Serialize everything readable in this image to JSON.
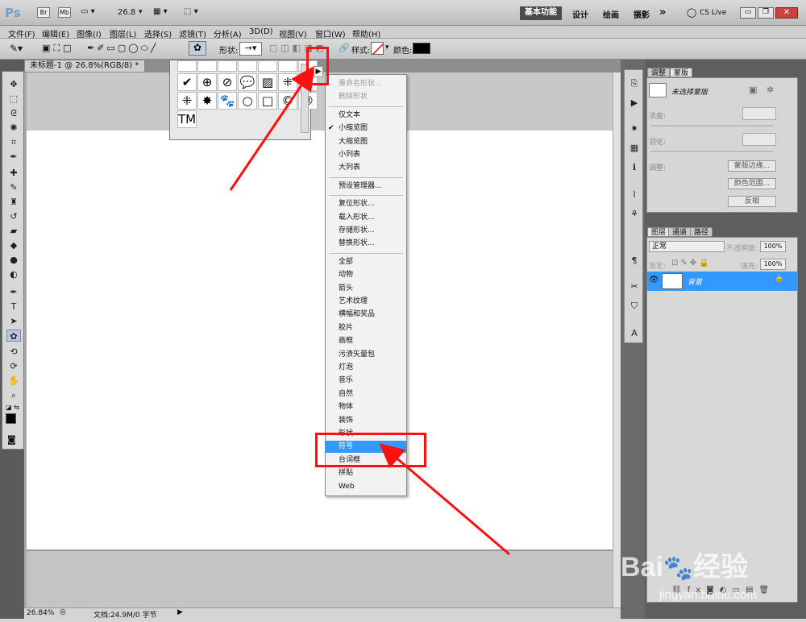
{
  "appbar": {
    "logo": "Ps",
    "br": "Br",
    "mb": "Mb",
    "zoom": "26.8",
    "workspace_basic": "基本功能",
    "workspace_design": "设计",
    "workspace_paint": "绘画",
    "workspace_photo": "摄影",
    "more": "»",
    "cslive": "CS Live"
  },
  "menubar": [
    "文件(F)",
    "编辑(E)",
    "图像(I)",
    "图层(L)",
    "选择(S)",
    "滤镜(T)",
    "分析(A)",
    "3D(D)",
    "视图(V)",
    "窗口(W)",
    "帮助(H)"
  ],
  "optbar": {
    "shape_label": "形状:",
    "style_label": "样式:",
    "color_label": "颜色:",
    "color_value": "#000000"
  },
  "doc": {
    "tab_title": "未标题-1 @ 26.8%(RGB/8) *",
    "zoom_status": "26.84%",
    "doc_status": "文档:24.9M/0 字节"
  },
  "shape_picker": {
    "glyphs": [
      "",
      "",
      "",
      "",
      "",
      "",
      "",
      "✔",
      "⊕",
      "⊘",
      "💬",
      "▨",
      "⁜",
      "",
      "⁜",
      "✸",
      "🐾",
      "○",
      "□",
      "©",
      "®",
      "TM"
    ]
  },
  "context_menu": {
    "items": [
      {
        "label": "重命名形状...",
        "disabled": true,
        "checked": false,
        "selected": false
      },
      {
        "label": "删除形状",
        "disabled": true,
        "checked": false,
        "selected": false
      },
      {
        "label": "仅文本",
        "disabled": false,
        "checked": false,
        "selected": false
      },
      {
        "label": "小缩览图",
        "disabled": false,
        "checked": true,
        "selected": false
      },
      {
        "label": "大缩览图",
        "disabled": false,
        "checked": false,
        "selected": false
      },
      {
        "label": "小列表",
        "disabled": false,
        "checked": false,
        "selected": false
      },
      {
        "label": "大列表",
        "disabled": false,
        "checked": false,
        "selected": false
      },
      {
        "label": "预设管理器...",
        "disabled": false,
        "checked": false,
        "selected": false
      },
      {
        "label": "复位形状...",
        "disabled": false,
        "checked": false,
        "selected": false
      },
      {
        "label": "载入形状...",
        "disabled": false,
        "checked": false,
        "selected": false
      },
      {
        "label": "存储形状...",
        "disabled": false,
        "checked": false,
        "selected": false
      },
      {
        "label": "替换形状...",
        "disabled": false,
        "checked": false,
        "selected": false
      },
      {
        "label": "全部",
        "disabled": false,
        "checked": false,
        "selected": false
      },
      {
        "label": "动物",
        "disabled": false,
        "checked": false,
        "selected": false
      },
      {
        "label": "箭头",
        "disabled": false,
        "checked": false,
        "selected": false
      },
      {
        "label": "艺术纹理",
        "disabled": false,
        "checked": false,
        "selected": false
      },
      {
        "label": "横幅和奖品",
        "disabled": false,
        "checked": false,
        "selected": false
      },
      {
        "label": "胶片",
        "disabled": false,
        "checked": false,
        "selected": false
      },
      {
        "label": "画框",
        "disabled": false,
        "checked": false,
        "selected": false
      },
      {
        "label": "污渍矢量包",
        "disabled": false,
        "checked": false,
        "selected": false
      },
      {
        "label": "灯泡",
        "disabled": false,
        "checked": false,
        "selected": false
      },
      {
        "label": "音乐",
        "disabled": false,
        "checked": false,
        "selected": false
      },
      {
        "label": "自然",
        "disabled": false,
        "checked": false,
        "selected": false
      },
      {
        "label": "物体",
        "disabled": false,
        "checked": false,
        "selected": false
      },
      {
        "label": "装饰",
        "disabled": false,
        "checked": false,
        "selected": false
      },
      {
        "label": "形状",
        "disabled": false,
        "checked": false,
        "selected": false
      },
      {
        "label": "符号",
        "disabled": false,
        "checked": false,
        "selected": true
      },
      {
        "label": "台词框",
        "disabled": false,
        "checked": false,
        "selected": false
      },
      {
        "label": "拼贴",
        "disabled": false,
        "checked": false,
        "selected": false
      },
      {
        "label": "Web",
        "disabled": false,
        "checked": false,
        "selected": false
      }
    ]
  },
  "mask_panel": {
    "tab_adjust": "调整",
    "tab_mask": "蒙版",
    "title": "未选择蒙版",
    "density_label": "浓度:",
    "feather_label": "羽化:",
    "adjust_label": "调整:",
    "btn_edge": "蒙版边缘...",
    "btn_color_range": "颜色范围...",
    "btn_invert": "反相"
  },
  "layers_panel": {
    "tab_layers": "图层",
    "tab_channels": "通道",
    "tab_paths": "路径",
    "blend_mode": "正常",
    "opacity_label": "不透明度:",
    "opacity_value": "100%",
    "lock_label": "锁定:",
    "fill_label": "填充:",
    "fill_value": "100%",
    "layer_name": "背景"
  },
  "watermark": {
    "brand": "Bai",
    "brand2": "经验",
    "url": "jingyan.baidu.com"
  },
  "colors": {
    "accent": "#3399ff",
    "annotation": "#ff1010"
  }
}
